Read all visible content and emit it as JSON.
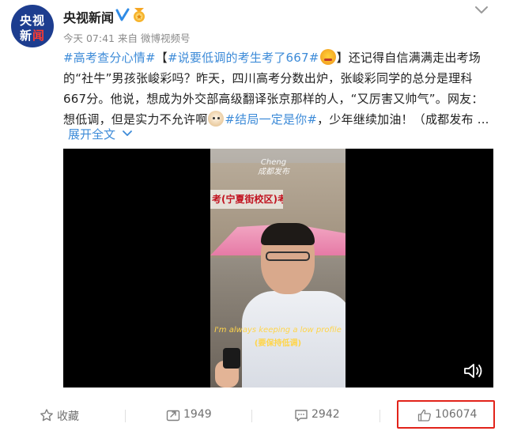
{
  "author": {
    "avatar_line1": "央视",
    "avatar_line2_a": "新",
    "avatar_line2_b": "闻",
    "name": "央视新闻",
    "verified_icon": "verified-v-icon",
    "badge_icon": "medal-icon"
  },
  "meta": {
    "time": "今天 07:41",
    "from_label": "来自",
    "source": "微博视频号"
  },
  "post": {
    "tag1": "#高考查分心情#",
    "bracket_open": "【",
    "tag2": "#说要低调的考生考了667#",
    "bracket_close": "】",
    "text1": "还记得自信满满走出考场的“社牛”男孩张峻彩吗？昨天，四川高考分数出炉，张峻彩同学的总分是理科667分。他说，想成为外交部高级翻译张京那样的人，“又厉害又帅气”。网友：想低调，但是实力不允许啊",
    "tag3": "#结局一定是你#",
    "text2": "，少年继续加油！（成都发布 ..."
  },
  "expand_label": "展开全文",
  "video": {
    "banner_text": "考(宁夏街校区)考点",
    "watermark_line1": "Cheng",
    "watermark_line2": "成都发布",
    "subtitle_en": "I'm always keeping a low profile",
    "subtitle_zh": "(要保持低调)"
  },
  "actions": {
    "favorite_label": "收藏",
    "repost_count": "1949",
    "comment_count": "2942",
    "like_count": "106074"
  },
  "colors": {
    "link": "#3d8bd8",
    "highlight_box": "#e2231a",
    "avatar_bg": "#1d3d8f"
  }
}
